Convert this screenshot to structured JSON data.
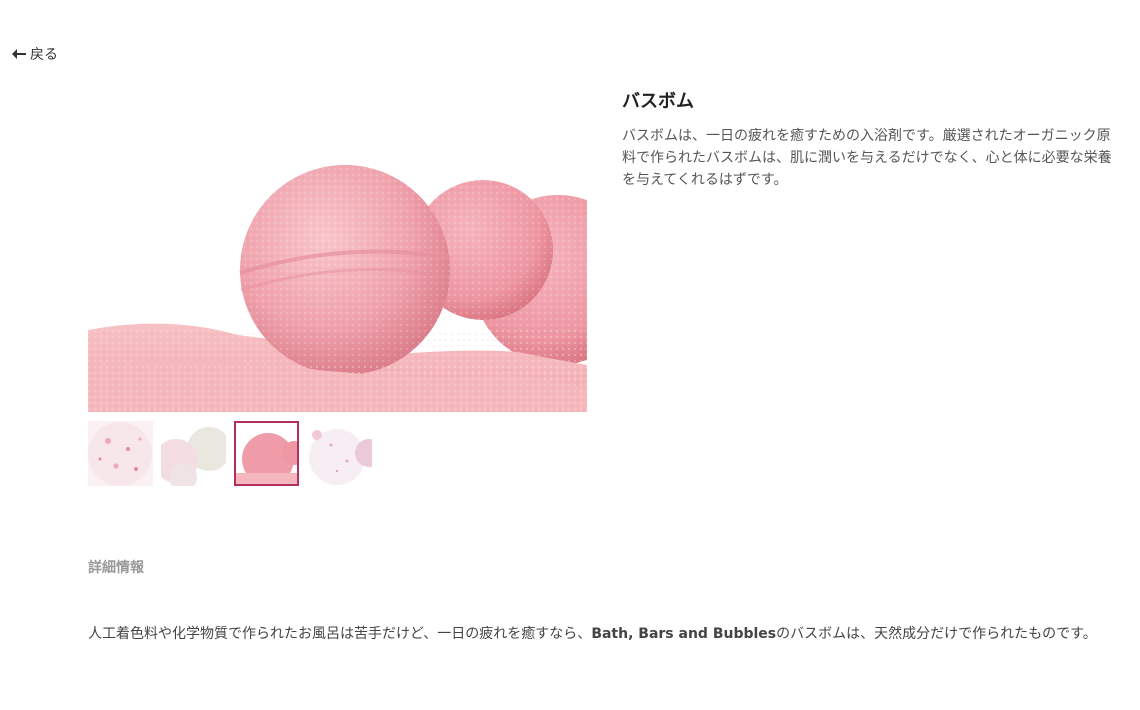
{
  "nav": {
    "back_label": "戻る"
  },
  "product": {
    "title": "バスボム",
    "description": "バスボムは、一日の疲れを癒すための入浴剤です。厳選されたオーガニック原料で作られたバスボムは、肌に潤いを与えるだけでなく、心と体に必要な栄養を与えてくれるはずです。",
    "thumbnails": [
      {
        "icon": "white-pink-bath-bomb-image",
        "selected": false
      },
      {
        "icon": "white-bath-bombs-image",
        "selected": false
      },
      {
        "icon": "pink-bath-bomb-image",
        "selected": true
      },
      {
        "icon": "white-sparkle-bath-bomb-image",
        "selected": false
      }
    ]
  },
  "details": {
    "heading": "詳細情報",
    "text_before": "人工着色料や化学物質で作られたお風呂は苦手だけど、一日の疲れを癒すなら、",
    "brand": "Bath, Bars and Bubbles",
    "text_after": "のバスボムは、天然成分だけで作られたものです。"
  },
  "colors": {
    "selected_border": "#b03060",
    "bath_bomb_pink": "#f2a3ad"
  }
}
